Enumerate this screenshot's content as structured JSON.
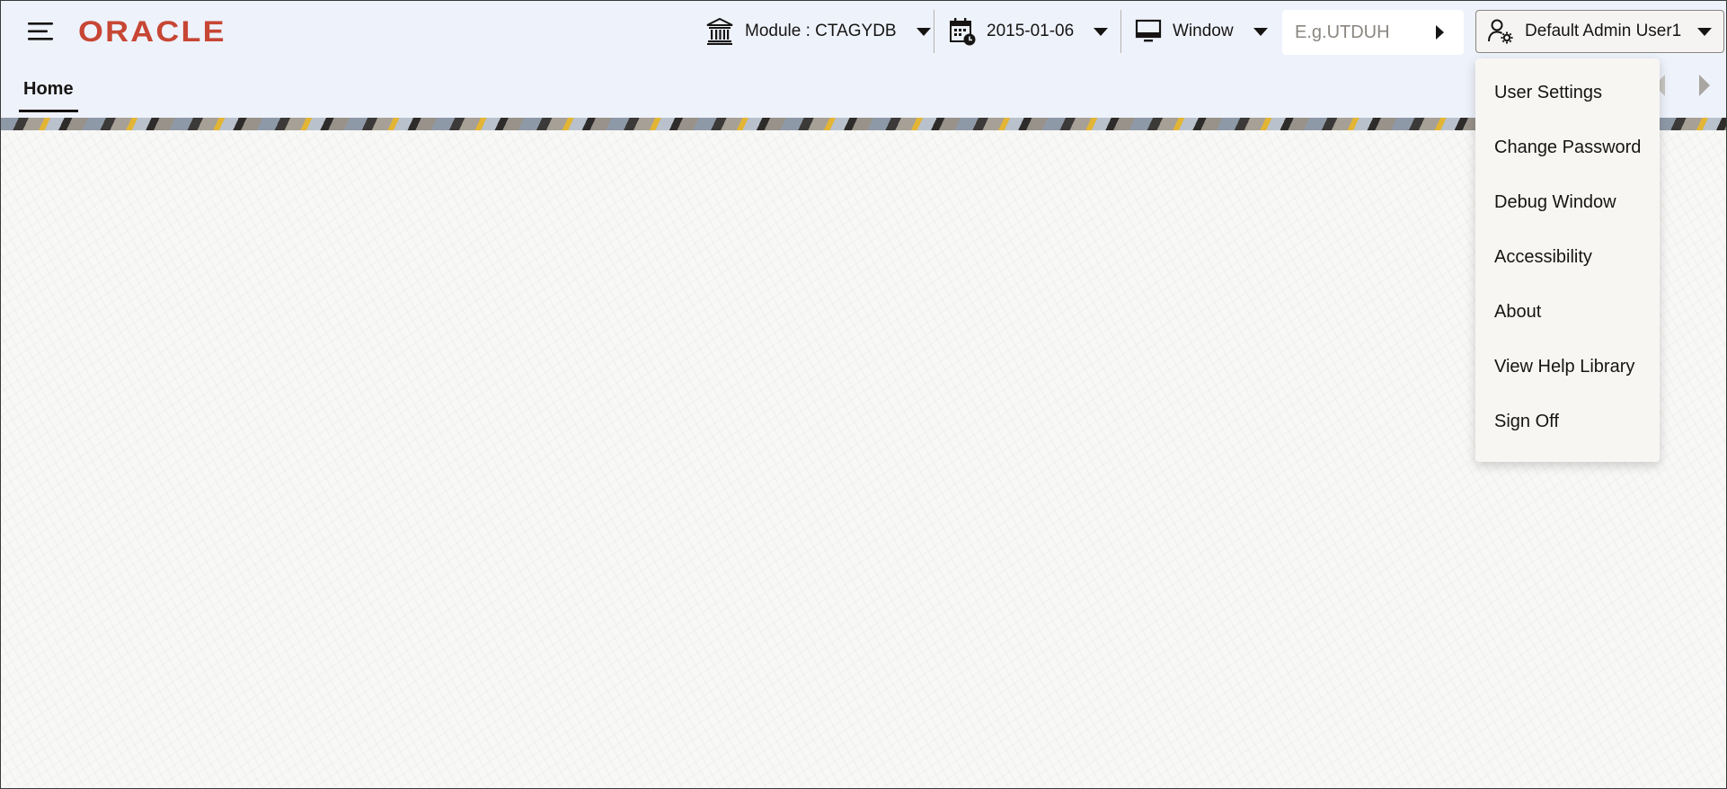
{
  "header": {
    "logo_text": "ORACLE",
    "module_label": "Module : CTAGYDB",
    "date_label": "2015-01-06",
    "window_label": "Window",
    "search_placeholder": "E.g.UTDUH",
    "user_label": "Default Admin User1"
  },
  "tabs": [
    {
      "label": "Home"
    }
  ],
  "user_menu": {
    "items": [
      {
        "label": "User Settings"
      },
      {
        "label": "Change Password"
      },
      {
        "label": "Debug Window"
      },
      {
        "label": "Accessibility"
      },
      {
        "label": "About"
      },
      {
        "label": "View Help Library"
      },
      {
        "label": "Sign Off"
      }
    ]
  },
  "icons": {
    "menu": "hamburger-icon",
    "module": "bank-icon",
    "date": "calendar-clock-icon",
    "window": "monitor-icon",
    "user": "user-settings-icon"
  },
  "colors": {
    "brand": "#c74634",
    "header_bg": "#eef2fb",
    "text": "#161513",
    "menu_bg": "#f8f6f3"
  }
}
